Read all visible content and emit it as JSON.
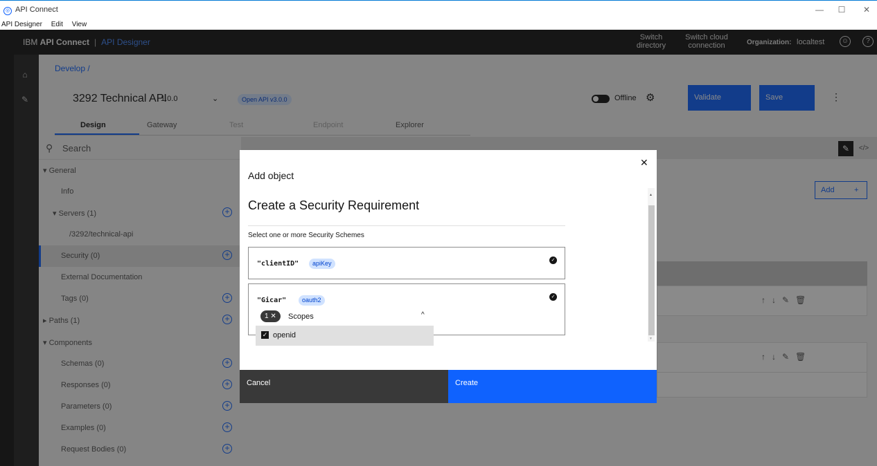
{
  "window": {
    "title": "API Connect",
    "min": "—",
    "max": "☐",
    "close": "✕"
  },
  "menubar": {
    "items": [
      "API Designer",
      "Edit",
      "View"
    ]
  },
  "header": {
    "brand_ibm": "IBM ",
    "brand_product": "API Connect",
    "brand_app": "API Designer",
    "switch_directory": "Switch directory",
    "switch_cloud": "Switch cloud connection",
    "org_label": "Organization:",
    "org_value": "localtest"
  },
  "breadcrumb": "Develop /",
  "api": {
    "title": "3292 Technical API",
    "version": "1.0.0",
    "spec_tag": "Open API v3.0.0",
    "offline_label": "Offline",
    "validate_label": "Validate",
    "save_label": "Save"
  },
  "tabs": {
    "design": "Design",
    "gateway": "Gateway",
    "test": "Test",
    "endpoint": "Endpoint",
    "explorer": "Explorer"
  },
  "nav": {
    "search_placeholder": "Search",
    "general": "General",
    "info": "Info",
    "servers": "Servers (1)",
    "server_path": "/3292/technical-api",
    "security": "Security (0)",
    "external_docs": "External Documentation",
    "tags": "Tags (0)",
    "paths": "Paths (1)",
    "components": "Components",
    "schemas": "Schemas (0)",
    "responses": "Responses (0)",
    "parameters": "Parameters (0)",
    "examples": "Examples (0)",
    "request_bodies": "Request Bodies (0)"
  },
  "content": {
    "add_label": "Add"
  },
  "modal": {
    "label": "Add object",
    "heading": "Create a Security Requirement",
    "description": "Select one or more Security Schemes",
    "schemes": [
      {
        "name": "\"clientID\"",
        "type": "apiKey"
      },
      {
        "name": "\"Gicar\"",
        "type": "oauth2"
      }
    ],
    "scopes": {
      "count": "1",
      "label": "Scopes",
      "option": "openid"
    },
    "cancel_label": "Cancel",
    "create_label": "Create"
  },
  "colors": {
    "primary": "#0f62fe",
    "tag_bg": "#d0e2ff",
    "dark": "#161616"
  }
}
